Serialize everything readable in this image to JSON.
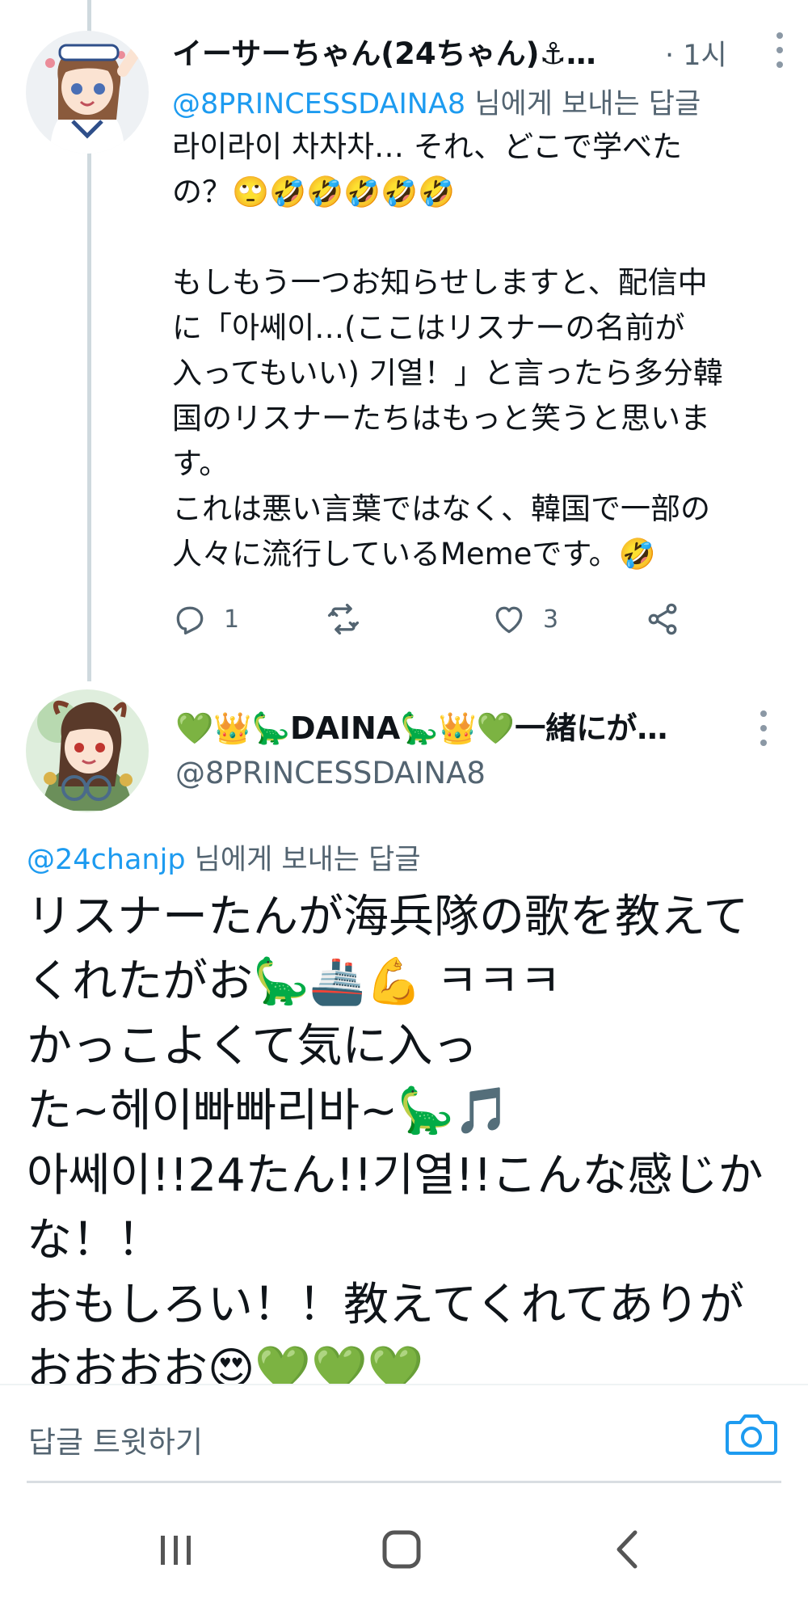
{
  "tweet1": {
    "display_name": "イーサーちゃん(24ちゃん)⚓…",
    "time": "· 1시",
    "reply_handle": "@8PRINCESSDAINA8",
    "reply_suffix": " 님에게 보내는 답글",
    "body": "라이라이 차차차… それ、どこで学べた\nの？🙄🤣🤣🤣🤣🤣\n\nもしもう一つお知らせしますと、配信中\nに「아쎄이…(ここはリスナーの名前が\n入ってもいい) 기열！」と言ったら多分韓\n国のリスナーたちはもっと笑うと思いま\nす。\nこれは悪い言葉ではなく、韓国で一部の\n人々に流行しているMemeです。🤣",
    "reply_count": "1",
    "retweet_count": "",
    "like_count": "3"
  },
  "tweet2": {
    "display_name": "💚👑🦕DAINA🦕👑💚一緒にが…",
    "handle": "@8PRINCESSDAINA8",
    "reply_handle": "@24chanjp",
    "reply_suffix": " 님에게 보내는 답글",
    "body": "リスナーたんが海兵隊の歌を教えて\nくれたがお🦕🚢💪 ㅋㅋㅋ\nかっこよくて気に入っ\nた~헤이빠빠리바~🦕🎵\n아쎄이!!24たん!!기열!!こんな感じか\nな！！\nおもしろい！！教えてくれてありが\nおおおお😍💚💚💚"
  },
  "reply_bar": {
    "placeholder": "답글 트윗하기"
  },
  "icons": {
    "reply": "reply-icon",
    "retweet": "retweet-icon",
    "like": "heart-icon",
    "share": "share-icon",
    "camera": "camera-icon",
    "more": "more-vertical-icon",
    "nav_recent": "recent-apps-icon",
    "nav_home": "home-icon",
    "nav_back": "back-icon"
  },
  "colors": {
    "accent": "#1d9bf0",
    "secondary_text": "#536471",
    "thread_line": "#cfd9de"
  }
}
